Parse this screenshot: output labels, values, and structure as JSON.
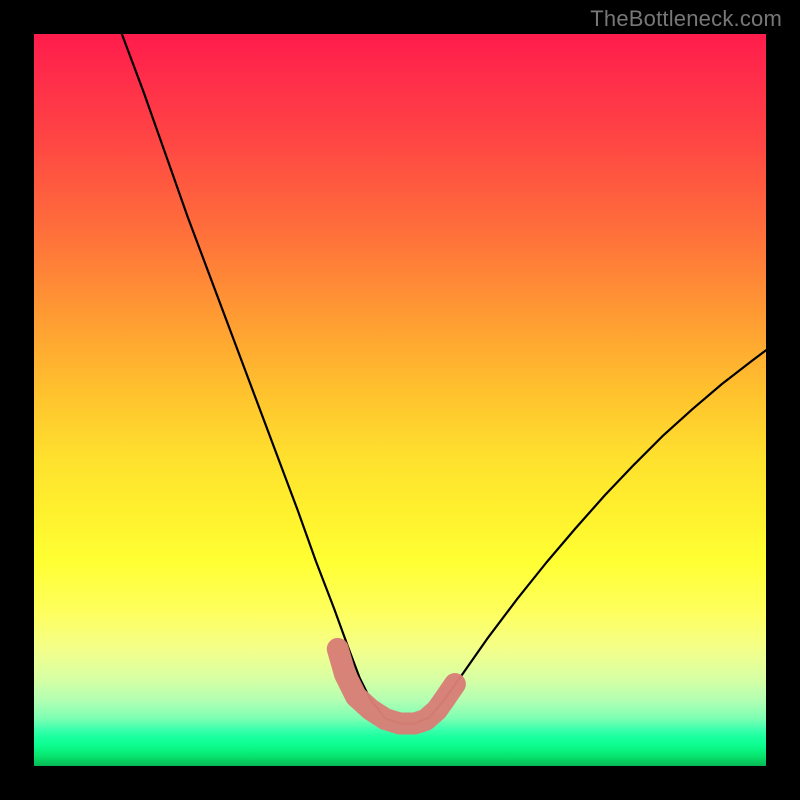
{
  "watermark": "TheBottleneck.com",
  "chart_data": {
    "type": "line",
    "title": "",
    "xlabel": "",
    "ylabel": "",
    "xlim": [
      0,
      100
    ],
    "ylim": [
      0,
      100
    ],
    "grid": false,
    "legend": false,
    "series": [
      {
        "name": "bottleneck-curve",
        "color": "#000000",
        "x": [
          12,
          15,
          18,
          21,
          24,
          27,
          30,
          33,
          36,
          38.5,
          41,
          43,
          44.5,
          46,
          48,
          50,
          52,
          54,
          56,
          58.5,
          62,
          66,
          70,
          74,
          78,
          82,
          86,
          90,
          94,
          98,
          100
        ],
        "values": [
          100,
          92,
          83.5,
          75,
          67,
          59,
          51,
          43,
          35,
          28,
          21.5,
          16,
          12,
          9,
          6.5,
          5.8,
          5.8,
          6.6,
          9,
          12.5,
          17.5,
          22.8,
          27.8,
          32.5,
          37,
          41.2,
          45.2,
          48.8,
          52.2,
          55.3,
          56.8
        ]
      },
      {
        "name": "highlight-band",
        "color": "#d87f77",
        "x": [
          41.5,
          42.5,
          44,
          46,
          48,
          50,
          52,
          53.5,
          55,
          56,
          57.5
        ],
        "values": [
          16,
          12.5,
          9.5,
          7.7,
          6.4,
          5.8,
          5.8,
          6.3,
          7.6,
          9,
          11.2
        ]
      }
    ],
    "annotations": []
  }
}
